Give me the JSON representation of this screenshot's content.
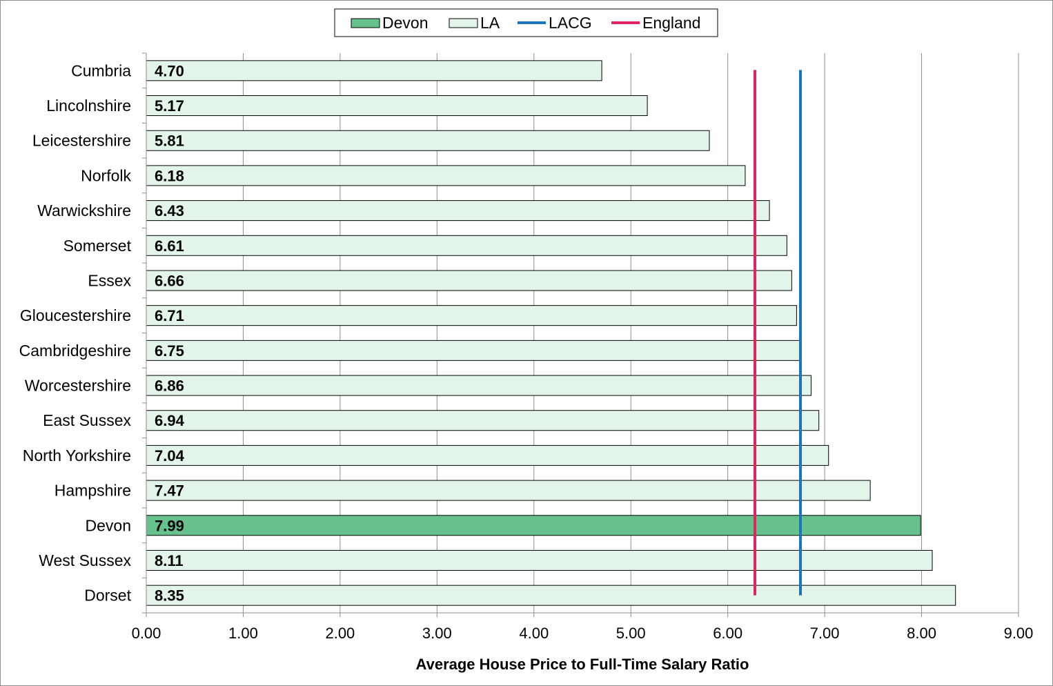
{
  "chart_data": {
    "type": "bar",
    "orientation": "horizontal",
    "categories": [
      "Cumbria",
      "Lincolnshire",
      "Leicestershire",
      "Norfolk",
      "Warwickshire",
      "Somerset",
      "Essex",
      "Gloucestershire",
      "Cambridgeshire",
      "Worcestershire",
      "East Sussex",
      "North Yorkshire",
      "Hampshire",
      "Devon",
      "West Sussex",
      "Dorset"
    ],
    "values": [
      4.7,
      5.17,
      5.81,
      6.18,
      6.43,
      6.61,
      6.66,
      6.71,
      6.75,
      6.86,
      6.94,
      7.04,
      7.47,
      7.99,
      8.11,
      8.35
    ],
    "value_labels": [
      "4.70",
      "5.17",
      "5.81",
      "6.18",
      "6.43",
      "6.61",
      "6.66",
      "6.71",
      "6.75",
      "6.86",
      "6.94",
      "7.04",
      "7.47",
      "7.99",
      "8.11",
      "8.35"
    ],
    "highlight_category": "Devon",
    "series": [
      {
        "name": "Devon",
        "kind": "bar",
        "color": "#66c18c"
      },
      {
        "name": "LA",
        "kind": "bar",
        "color": "#e3f4e8"
      },
      {
        "name": "LACG",
        "kind": "line",
        "color": "#1b75bc",
        "value": 6.75
      },
      {
        "name": "England",
        "kind": "line",
        "color": "#e0245e",
        "value": 6.28
      }
    ],
    "xlabel": "Average House Price to Full-Time Salary Ratio",
    "xlim": [
      0,
      9
    ],
    "xticks": [
      "0.00",
      "1.00",
      "2.00",
      "3.00",
      "4.00",
      "5.00",
      "6.00",
      "7.00",
      "8.00",
      "9.00"
    ],
    "grid": "vertical",
    "legend_position": "top-center"
  }
}
